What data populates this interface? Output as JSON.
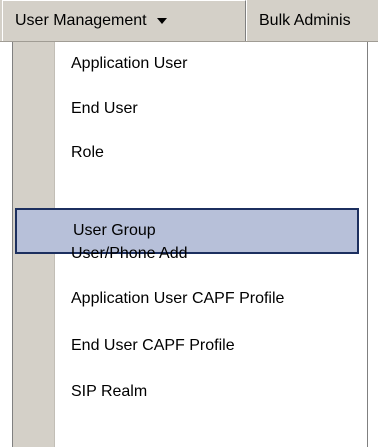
{
  "menubar": {
    "items": [
      {
        "label": "User Management",
        "active": true,
        "has_dropdown": true
      },
      {
        "label": "Bulk Adminis",
        "active": false
      }
    ],
    "caret_icon": "chevron-down-icon"
  },
  "dropdown": {
    "items": [
      {
        "label": "Application User"
      },
      {
        "label": "End User"
      },
      {
        "label": "Role"
      },
      {
        "label": "User Group",
        "selected": true
      },
      {
        "label": "User/Phone Add"
      },
      {
        "label": "Application User CAPF Profile"
      },
      {
        "label": "End User CAPF Profile"
      },
      {
        "label": "SIP Realm"
      }
    ]
  },
  "colors": {
    "menubar_bg": "#d4d0c8",
    "selected_bg": "#b7c0d9",
    "selected_border": "#1c2f5f"
  }
}
